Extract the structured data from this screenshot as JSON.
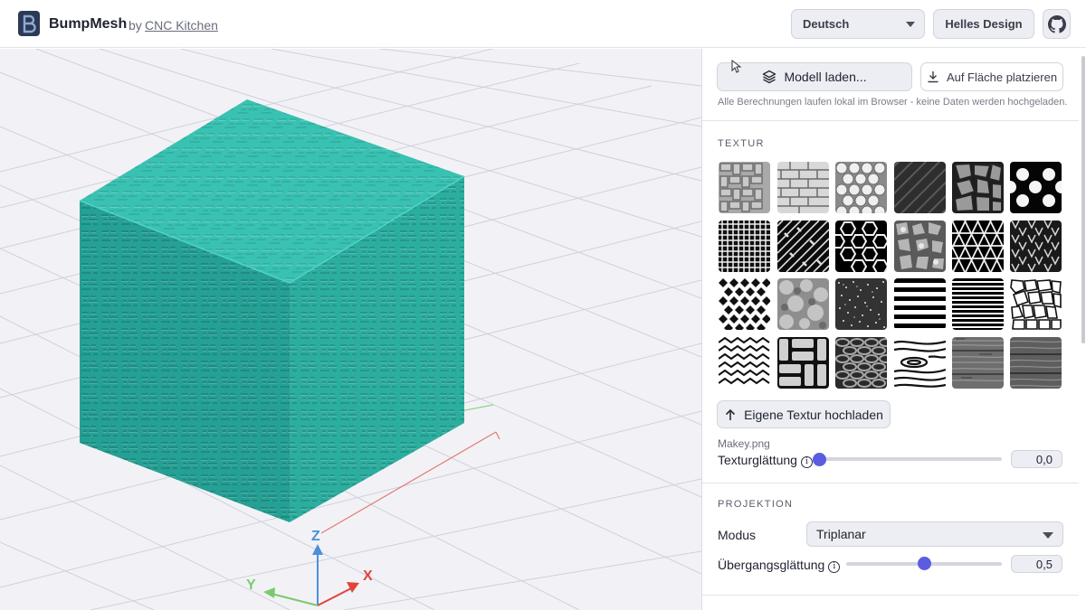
{
  "header": {
    "app_name": "BumpMesh",
    "by_text": "by",
    "author_link": "CNC Kitchen",
    "language_value": "Deutsch",
    "theme_label": "Helles Design",
    "github_icon": "github-icon"
  },
  "colors": {
    "mesh": "#2aa79b",
    "accent": "#5b5ce0",
    "axis_x": "#e0453b",
    "axis_y": "#7bc96f",
    "axis_z": "#4a90d9"
  },
  "viewport": {
    "axis_x_label": "X",
    "axis_y_label": "Y",
    "axis_z_label": "Z"
  },
  "panel": {
    "load_model_label": "Modell laden...",
    "place_on_face_label": "Auf Fläche platzieren",
    "privacy_note": "Alle Berechnungen laufen lokal im Browser - keine Daten werden hochgeladen.",
    "texture": {
      "title": "TEXTUR",
      "swatches": [
        "basket-weave",
        "bricks",
        "hex-bubbles",
        "carbon-fiber",
        "voronoi-stones",
        "dots",
        "square-grid",
        "diagonal-weave",
        "hexagons",
        "crackle",
        "triangles",
        "knit",
        "diamonds",
        "noise-blobs",
        "fine-noise",
        "horizontal-stripes",
        "fine-stripes",
        "voronoi-cells",
        "chevron-scales",
        "basket",
        "chainmail",
        "wood-grain",
        "wood-planks",
        "wood-dark"
      ],
      "upload_label": "Eigene Textur hochladen",
      "file_name": "Makey.png",
      "smoothing_label": "Texturglättung",
      "smoothing_value": "0,0",
      "smoothing_fraction": 0.0
    },
    "projection": {
      "title": "PROJEKTION",
      "mode_label": "Modus",
      "mode_value": "Triplanar",
      "transition_label": "Übergangsglättung",
      "transition_value": "0,5",
      "transition_fraction": 0.5
    }
  }
}
